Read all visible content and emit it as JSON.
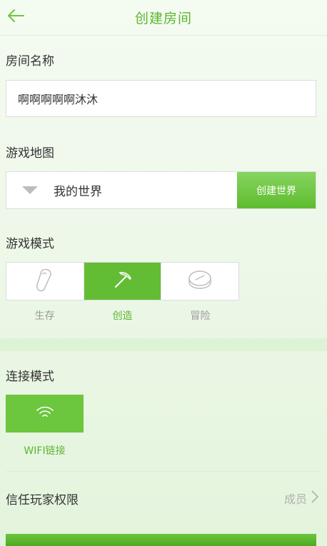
{
  "header": {
    "title": "创建房间",
    "accent_color": "#5cb531"
  },
  "room_name": {
    "label": "房间名称",
    "value": "啊啊啊啊啊沐沐"
  },
  "game_map": {
    "label": "游戏地图",
    "selected": "我的世界",
    "create_button": "创建世界"
  },
  "game_mode": {
    "label": "游戏模式",
    "options": [
      {
        "label": "生存",
        "icon": "bread-icon",
        "active": false
      },
      {
        "label": "创造",
        "icon": "pickaxe-icon",
        "active": true
      },
      {
        "label": "冒险",
        "icon": "compass-icon",
        "active": false
      }
    ]
  },
  "connection": {
    "label": "连接模式",
    "option_label": "WIFI链接",
    "icon": "wifi-icon"
  },
  "trust": {
    "label": "信任玩家权限",
    "value": "成员"
  }
}
